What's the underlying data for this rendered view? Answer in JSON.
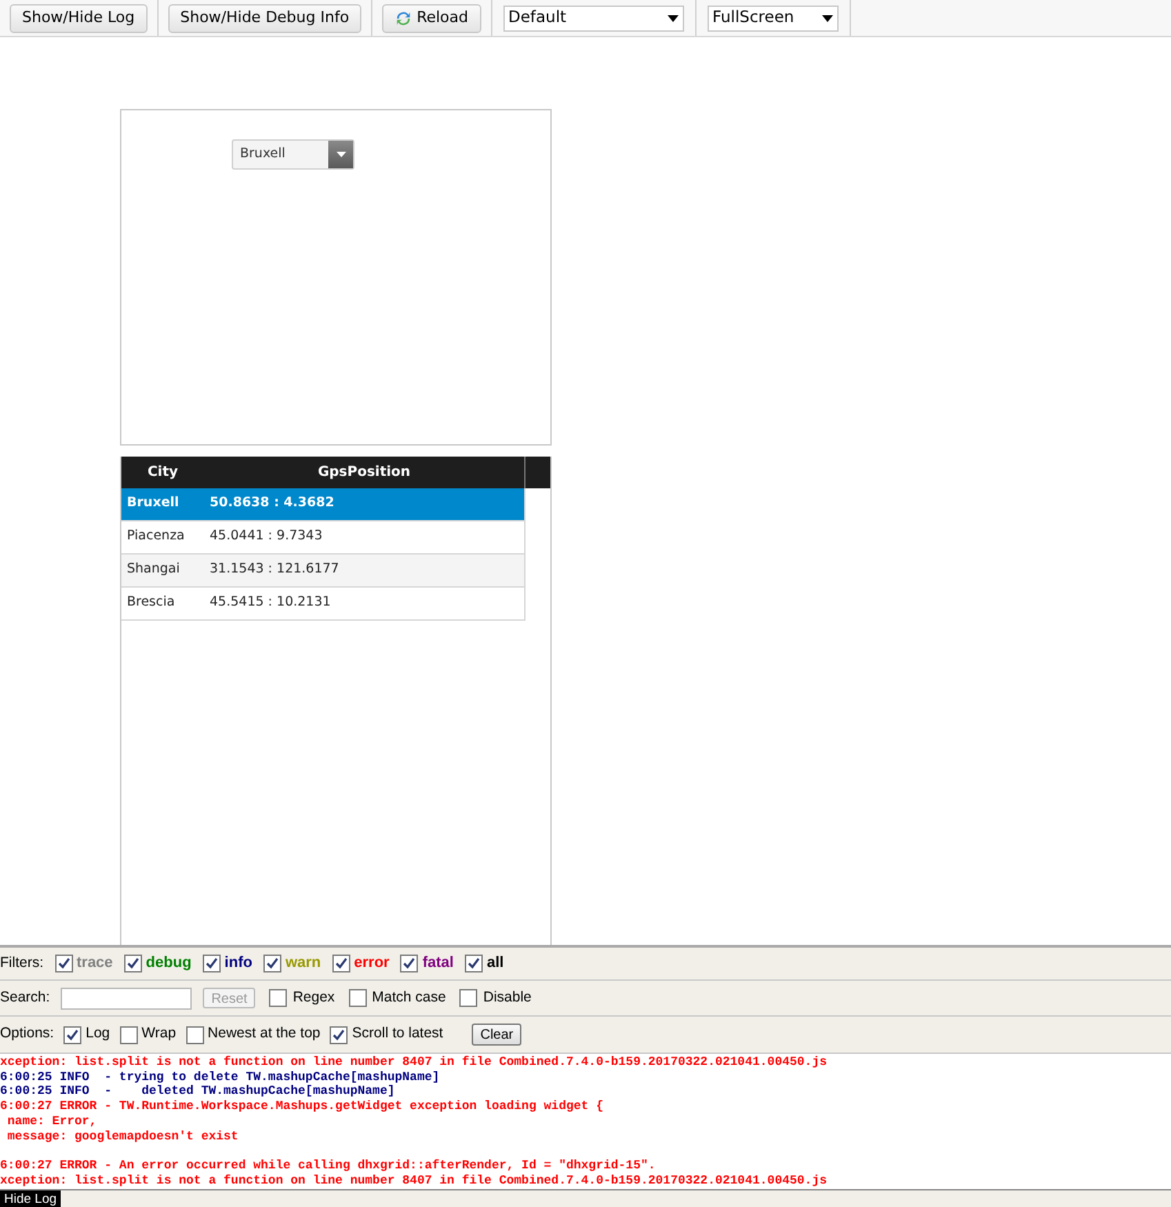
{
  "toolbar": {
    "buttons": [
      {
        "label": "Show/Hide Log",
        "kind": "plain"
      },
      {
        "label": "Show/Hide Debug Info",
        "kind": "plain"
      },
      {
        "label": "Reload",
        "kind": "reload"
      }
    ],
    "selects": [
      {
        "value": "Default"
      },
      {
        "value": "FullScreen"
      }
    ]
  },
  "mashup": {
    "city_dropdown": {
      "value": "Bruxell"
    },
    "grid": {
      "columns": [
        "City",
        "GpsPosition"
      ],
      "rows": [
        {
          "cells": [
            "Bruxell",
            "50.8638 : 4.3682"
          ],
          "selected": true
        },
        {
          "cells": [
            "Piacenza",
            "45.0441 : 9.7343"
          ],
          "selected": false
        },
        {
          "cells": [
            "Shangai",
            "31.1543 : 121.6177"
          ],
          "selected": false
        },
        {
          "cells": [
            "Brescia",
            "45.5415 : 10.2131"
          ],
          "selected": false
        }
      ]
    }
  },
  "log": {
    "filters_label": "Filters:",
    "filters": [
      {
        "label": "trace",
        "checked": true,
        "color": "#808080"
      },
      {
        "label": "debug",
        "checked": true,
        "color": "#008000"
      },
      {
        "label": "info",
        "checked": true,
        "color": "#000080"
      },
      {
        "label": "warn",
        "checked": true,
        "color": "#999900"
      },
      {
        "label": "error",
        "checked": true,
        "color": "#ff0000"
      },
      {
        "label": "fatal",
        "checked": true,
        "color": "#800080"
      },
      {
        "label": "all",
        "checked": true,
        "color": "#000000"
      }
    ],
    "search_label": "Search:",
    "reset": "Reset",
    "search_options": [
      {
        "label": "Regex",
        "checked": false
      },
      {
        "label": "Match case",
        "checked": false
      },
      {
        "label": "Disable",
        "checked": false
      }
    ],
    "options_label": "Options:",
    "options": [
      {
        "label": "Log",
        "checked": true
      },
      {
        "label": "Wrap",
        "checked": false
      },
      {
        "label": "Newest at the top",
        "checked": false
      },
      {
        "label": "Scroll to latest",
        "checked": true
      }
    ],
    "clear": "Clear",
    "lines": [
      {
        "text": "xception: list.split is not a function on line number 8407 in file Combined.7.4.0-b159.20170322.021041.00450.js",
        "kind": "error"
      },
      {
        "text": "6:00:25 INFO  - trying to delete TW.mashupCache[mashupName]",
        "kind": "info"
      },
      {
        "text": "6:00:25 INFO  -    deleted TW.mashupCache[mashupName]",
        "kind": "info"
      },
      {
        "text": "6:00:27 ERROR - TW.Runtime.Workspace.Mashups.getWidget exception loading widget {",
        "kind": "error"
      },
      {
        "text": " name: Error,",
        "kind": "error"
      },
      {
        "text": " message: googlemapdoesn't exist",
        "kind": "error"
      },
      {
        "text": "6:00:27 ERROR - An error occurred while calling dhxgrid::afterRender, Id = \"dhxgrid-15\".",
        "kind": "error",
        "blank_before": true
      },
      {
        "text": "xception: list.split is not a function on line number 8407 in file Combined.7.4.0-b159.20170322.021041.00450.js",
        "kind": "error"
      }
    ],
    "hide_tab": "Hide Log"
  }
}
